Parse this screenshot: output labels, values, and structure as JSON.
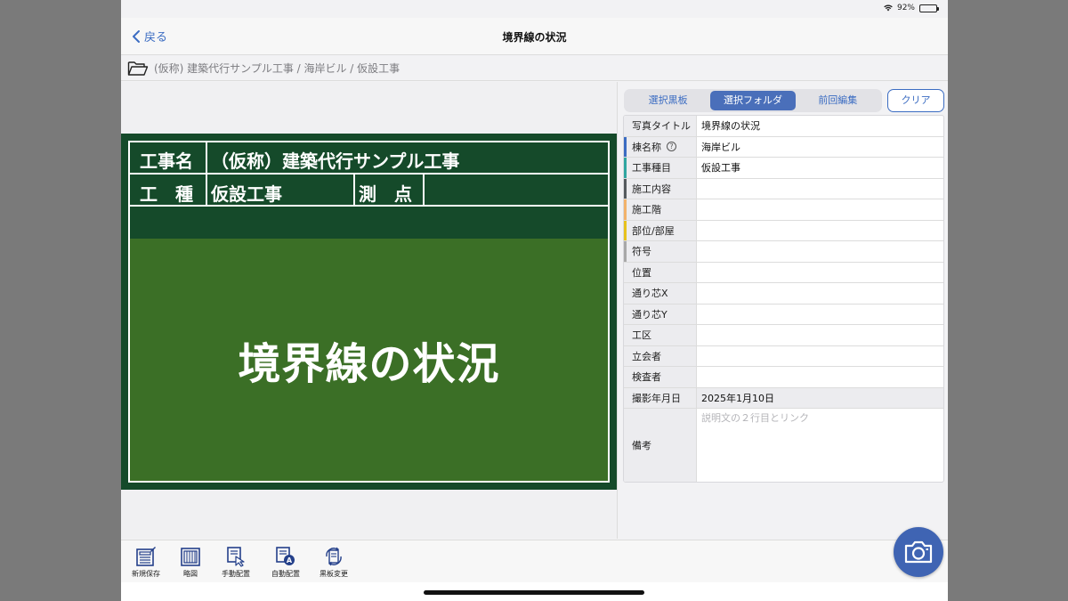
{
  "status_bar": {
    "battery_text": "92%",
    "battery_level": 0.92
  },
  "nav": {
    "back_label": "戻る",
    "title": "境界線の状況"
  },
  "breadcrumb": {
    "path": "(仮称) 建築代行サンプル工事 / 海岸ビル / 仮設工事"
  },
  "board": {
    "label_project": "工事名",
    "value_project": "（仮称）建築代行サンプル工事",
    "label_type": "工　種",
    "value_type": "仮設工事",
    "label_point": "測　点",
    "value_point": "",
    "photo_title": "境界線の状況"
  },
  "segments": [
    {
      "label": "選択黒板",
      "active": false
    },
    {
      "label": "選択フォルダ",
      "active": true
    },
    {
      "label": "前回編集",
      "active": false
    }
  ],
  "clear_label": "クリア",
  "fields": [
    {
      "label": "写真タイトル",
      "value": "境界線の状況",
      "stripe": ""
    },
    {
      "label": "棟名称",
      "value": "海岸ビル",
      "stripe": "#3b6cc2",
      "help": "?"
    },
    {
      "label": "工事種目",
      "value": "仮設工事",
      "stripe": "#2fa6a0"
    },
    {
      "label": "施工内容",
      "value": "",
      "stripe": "#555a5e"
    },
    {
      "label": "施工階",
      "value": "",
      "stripe": "#f2b26a"
    },
    {
      "label": "部位/部屋",
      "value": "",
      "stripe": "#e7c21d"
    },
    {
      "label": "符号",
      "value": "",
      "stripe": "#a8a8a8"
    },
    {
      "label": "位置",
      "value": "",
      "stripe": ""
    },
    {
      "label": "通り芯X",
      "value": "",
      "stripe": ""
    },
    {
      "label": "通り芯Y",
      "value": "",
      "stripe": ""
    },
    {
      "label": "工区",
      "value": "",
      "stripe": ""
    },
    {
      "label": "立会者",
      "value": "",
      "stripe": ""
    },
    {
      "label": "検査者",
      "value": "",
      "stripe": ""
    },
    {
      "label": "撮影年月日",
      "value": "2025年1月10日",
      "stripe": "",
      "gray": true
    },
    {
      "label": "備考",
      "value": "説明文の２行目とリンク",
      "stripe": "",
      "tall": true
    }
  ],
  "toolbar": [
    {
      "label": "新規保存",
      "icon": "save-board-icon"
    },
    {
      "label": "略図",
      "icon": "sketch-icon"
    },
    {
      "label": "手動配置",
      "icon": "manual-layout-icon"
    },
    {
      "label": "自動配置",
      "icon": "auto-layout-icon"
    },
    {
      "label": "黒板変更",
      "icon": "change-board-icon"
    }
  ],
  "colors": {
    "accent": "#3b6cc2",
    "board_dark": "#154a2a",
    "board_photo": "#3b6f26",
    "camera": "#3f64b3"
  }
}
